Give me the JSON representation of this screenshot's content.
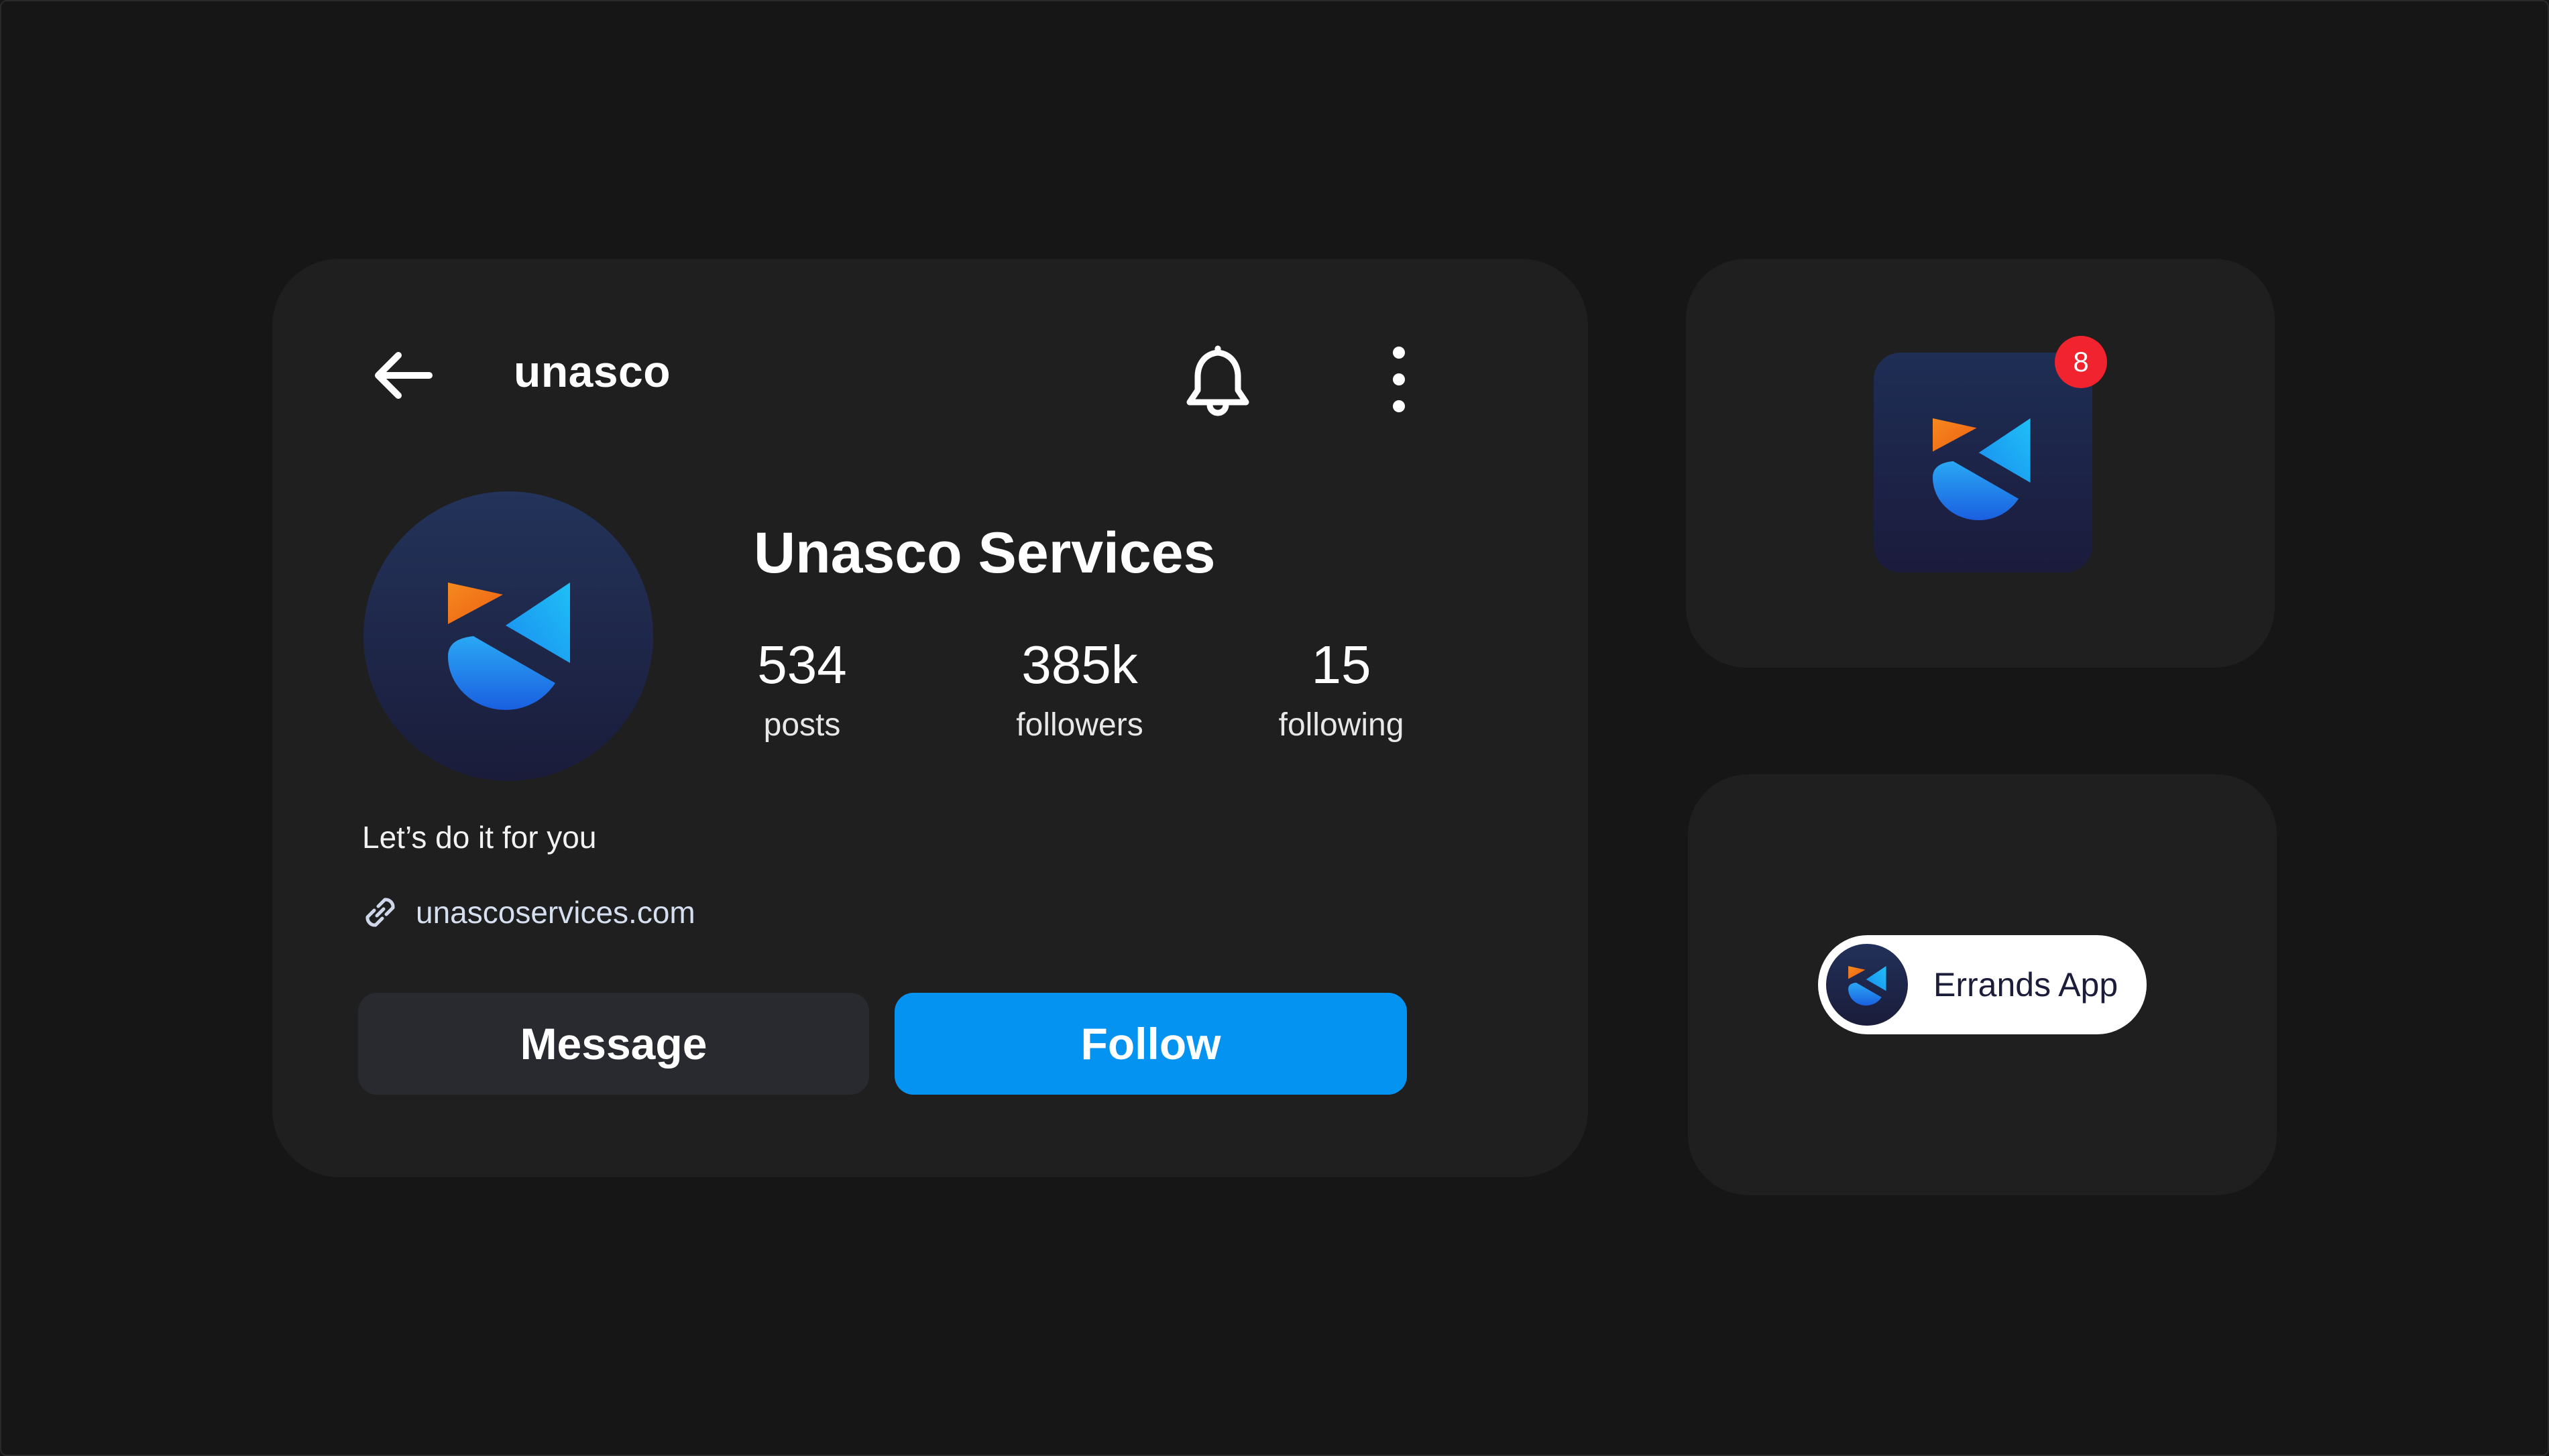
{
  "profile": {
    "handle": "unasco",
    "display_name": "Unasco Services",
    "stats": [
      {
        "value": "534",
        "label": "posts"
      },
      {
        "value": "385k",
        "label": "followers"
      },
      {
        "value": "15",
        "label": "following"
      }
    ],
    "bio": "Let’s do it for you",
    "website": "unascoservices.com",
    "actions": {
      "message_label": "Message",
      "follow_label": "Follow"
    }
  },
  "app_icon": {
    "badge_count": "8"
  },
  "app_chip": {
    "label": "Errands App"
  },
  "colors": {
    "background": "#161616",
    "card": "#1f1f1f",
    "follow_button": "#0493f1",
    "message_button": "#282a30",
    "badge": "#f0232e",
    "logo_orange": "#f27a1a",
    "logo_blue": "#1e6fe0"
  },
  "icons": {
    "back": "arrow-left-icon",
    "notifications": "bell-icon",
    "more": "more-vertical-icon",
    "link": "link-icon",
    "logo": "unasco-logo-icon"
  }
}
